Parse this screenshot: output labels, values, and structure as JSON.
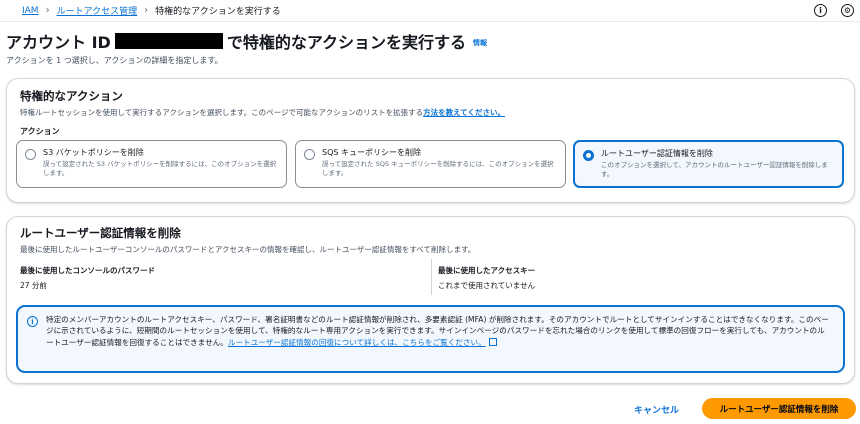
{
  "breadcrumb": {
    "items": [
      "IAM",
      "ルートアクセス管理"
    ],
    "current": "特権的なアクションを実行する"
  },
  "header": {
    "title_prefix": "アカウント ID",
    "title_suffix": "で特権的なアクションを実行する",
    "info_link": "情報",
    "description": "アクションを 1 つ選択し、アクションの詳細を指定します。"
  },
  "icons": {
    "help": "info-circle-icon",
    "settings": "gear-icon",
    "alert": "info-icon",
    "external": "external-link-icon"
  },
  "colors": {
    "link": "#0972d3",
    "primary_button": "#ff9900",
    "selected_border": "#0972d3"
  },
  "privileged_actions": {
    "title": "特権的なアクション",
    "description": "特権ルートセッションを使用して実行するアクションを選択します。このページで可能なアクションのリストを拡張する",
    "description_link": "方法を教えてください。",
    "field_label": "アクション",
    "options": [
      {
        "label": "S3 バケットポリシーを削除",
        "description": "誤って設定された S3 バケットポリシーを削除するには、このオプションを選択します。",
        "selected": false
      },
      {
        "label": "SQS キューポリシーを削除",
        "description": "誤って設定された SQS キューポリシーを削除するには、このオプションを選択します。",
        "selected": false
      },
      {
        "label": "ルートユーザー認証情報を削除",
        "description": "このオプションを選択して、アカウントのルートユーザー認証情報を削除します。",
        "selected": true
      }
    ]
  },
  "delete_credentials": {
    "title": "ルートユーザー認証情報を削除",
    "description": "最後に使用したルートユーザーコンソールのパスワードとアクセスキーの情報を確認し、ルートユーザー認証情報をすべて削除します。",
    "last_password_label": "最後に使用したコンソールのパスワード",
    "last_password_value": "27 分前",
    "last_access_key_label": "最後に使用したアクセスキー",
    "last_access_key_value": "これまで使用されていません",
    "alert_text": "特定のメンバーアカウントのルートアクセスキー、パスワード、署名証明書などのルート認証情報が削除され、多要素認証 (MFA) が削除されます。そのアカウントでルートとしてサインインすることはできなくなります。このページに示されているように、短期間のルートセッションを使用して、特権的なルート専用アクションを実行できます。サインインページのパスワードを忘れた場合のリンクを使用して標準の回復フローを実行しても、アカウントのルートユーザー認証情報を回復することはできません。",
    "alert_link": "ルートユーザー認証情報の回復について詳しくは、こちらをご覧ください。"
  },
  "footer": {
    "cancel_label": "キャンセル",
    "submit_label": "ルートユーザー認証情報を削除"
  }
}
